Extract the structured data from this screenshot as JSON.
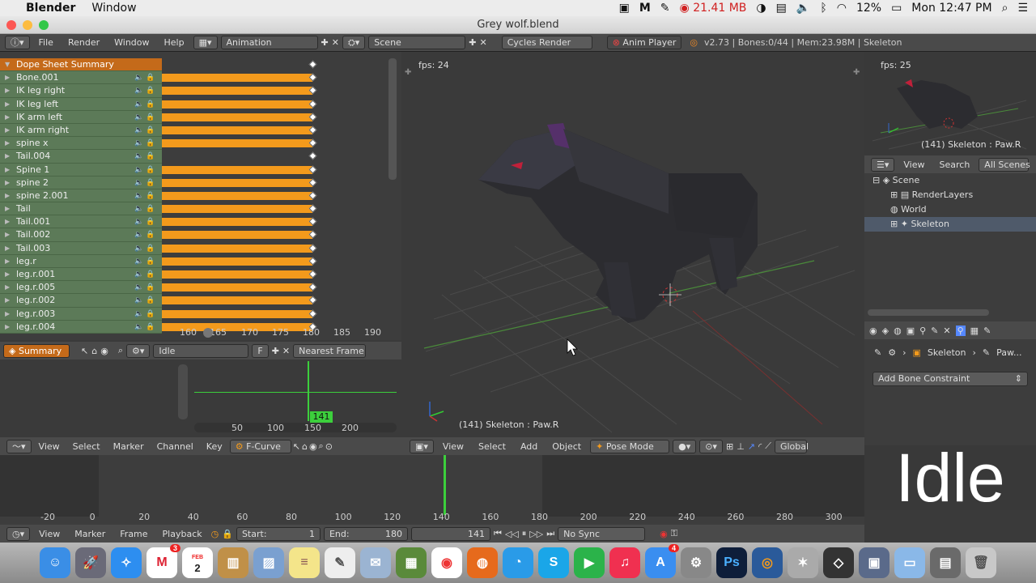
{
  "macbar": {
    "app_name": "Blender",
    "menu_window": "Window",
    "memory": "21.41 MB",
    "battery": "12%",
    "clock": "Mon 12:47 PM"
  },
  "window": {
    "title": "Grey wolf.blend"
  },
  "header": {
    "menus": [
      "File",
      "Render",
      "Window",
      "Help"
    ],
    "layout": "Animation",
    "scene": "Scene",
    "engine": "Cycles Render",
    "anim_player": "Anim Player",
    "stats": "v2.73 | Bones:0/44 | Mem:23.98M | Skeleton"
  },
  "dopesheet": {
    "summary": "Dope Sheet Summary",
    "channels": [
      {
        "name": "Bone.001",
        "keys": true
      },
      {
        "name": "IK leg right",
        "keys": true
      },
      {
        "name": "IK leg left",
        "keys": true
      },
      {
        "name": "IK arm left",
        "keys": true
      },
      {
        "name": "IK arm right",
        "keys": true
      },
      {
        "name": "spine x",
        "keys": true
      },
      {
        "name": "Tail.004",
        "keys": false
      },
      {
        "name": "Spine 1",
        "keys": true
      },
      {
        "name": "spine 2",
        "keys": true
      },
      {
        "name": "spine 2.001",
        "keys": true
      },
      {
        "name": "Tail",
        "keys": true
      },
      {
        "name": "Tail.001",
        "keys": true
      },
      {
        "name": "Tail.002",
        "keys": true
      },
      {
        "name": "Tail.003",
        "keys": true
      },
      {
        "name": "leg.r",
        "keys": true
      },
      {
        "name": "leg.r.001",
        "keys": true
      },
      {
        "name": "leg.r.005",
        "keys": true
      },
      {
        "name": "leg.r.002",
        "keys": true
      },
      {
        "name": "leg.r.003",
        "keys": true
      },
      {
        "name": "leg.r.004",
        "keys": true
      }
    ],
    "scale": [
      "160",
      "165",
      "170",
      "175",
      "180",
      "185",
      "190"
    ],
    "mode": "Summary",
    "action": "Idle",
    "action_flag": "F",
    "snap": "Nearest Frame"
  },
  "graph": {
    "frame": "141",
    "ticks": [
      "50",
      "100",
      "150",
      "200"
    ]
  },
  "graph_header": {
    "menus": [
      "View",
      "Select",
      "Marker",
      "Channel",
      "Key"
    ],
    "mode": "F-Curve"
  },
  "viewport": {
    "fps": "fps: 24",
    "status": "(141) Skeleton : Paw.R",
    "menus": [
      "View",
      "Select",
      "Add",
      "Object"
    ],
    "mode": "Pose Mode",
    "orientation": "Global"
  },
  "camera_preview": {
    "fps": "fps: 25",
    "status": "(141) Skeleton : Paw.R"
  },
  "outliner": {
    "menus": [
      "View",
      "Search"
    ],
    "filter": "All Scenes",
    "items": [
      {
        "label": "Scene",
        "indent": 0
      },
      {
        "label": "RenderLayers",
        "indent": 1
      },
      {
        "label": "World",
        "indent": 1
      },
      {
        "label": "Skeleton",
        "indent": 1
      }
    ]
  },
  "properties": {
    "breadcrumb_object": "Skeleton",
    "breadcrumb_bone": "Paw...",
    "add_constraint": "Add Bone Constraint"
  },
  "overlay_text": "Idle",
  "timeline": {
    "ticks": [
      "-20",
      "0",
      "20",
      "40",
      "60",
      "80",
      "100",
      "120",
      "140",
      "160",
      "180",
      "200",
      "220",
      "240",
      "260",
      "280",
      "300"
    ],
    "menus": [
      "View",
      "Marker",
      "Frame",
      "Playback"
    ],
    "start_label": "Start:",
    "start_value": "1",
    "end_label": "End:",
    "end_value": "180",
    "current_frame": "141",
    "sync": "No Sync"
  },
  "dock": {
    "apps": [
      "finder-icon",
      "launchpad-icon",
      "safari-icon",
      "gmail-icon",
      "calendar-icon",
      "contacts-icon",
      "preview-icon",
      "notes-icon",
      "textedit-icon",
      "mail-icon",
      "minecraft-icon",
      "chrome-icon",
      "firefox-icon",
      "messages-icon",
      "skype-icon",
      "facetime-icon",
      "itunes-icon",
      "appstore-icon",
      "systemprefs-icon",
      "photoshop-icon",
      "blender-icon",
      "figure-icon",
      "unity-icon",
      "screenrecorder-icon",
      "folder-icon",
      "applications-icon",
      "trash-icon"
    ],
    "badges": {
      "gmail": "3",
      "appstore": "4"
    },
    "calendar_month": "FEB",
    "calendar_day": "2",
    "ps_label": "Ps"
  },
  "colors": {
    "key_orange": "#f39a1c",
    "channel_green": "#5c7a58",
    "summary_orange": "#c46a1a",
    "playhead_green": "#3ccf3c"
  }
}
